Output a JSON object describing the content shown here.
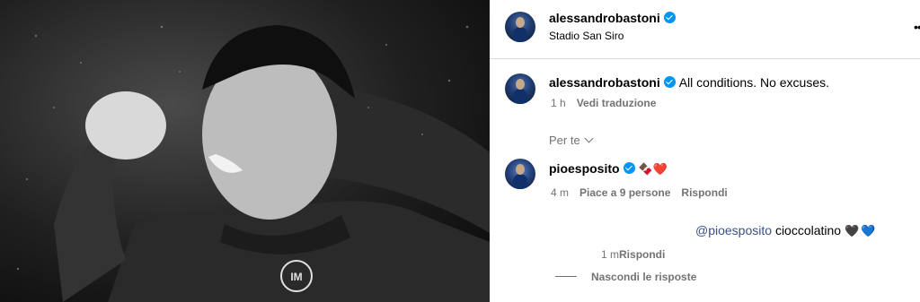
{
  "photo": {
    "alt": "",
    "colors": {
      "background": "#1a1a1a"
    }
  },
  "header": {
    "username": "alessandrobastoni",
    "location": "Stadio San Siro",
    "more_icon": "ellipsis-icon"
  },
  "caption": {
    "username": "alessandrobastoni",
    "text": "All conditions. No excuses.",
    "time": "1 h",
    "translate": "Vedi traduzione"
  },
  "filter": {
    "label": "Per te"
  },
  "comment": {
    "username": "pioesposito",
    "emojis": "🍫❤️",
    "time": "4 m",
    "likes": "Piace a 9 persone",
    "reply": "Rispondi"
  },
  "reply": {
    "mention": "@pioesposito",
    "text": "cioccolatino",
    "heart1": "🖤",
    "heart2": "💙",
    "time": "1 m",
    "reply": "Rispondi"
  },
  "hide_replies": {
    "label": "Nascondi le risposte"
  },
  "colors": {
    "accent": "#0095f6",
    "mention": "#385185",
    "muted": "#737373"
  }
}
